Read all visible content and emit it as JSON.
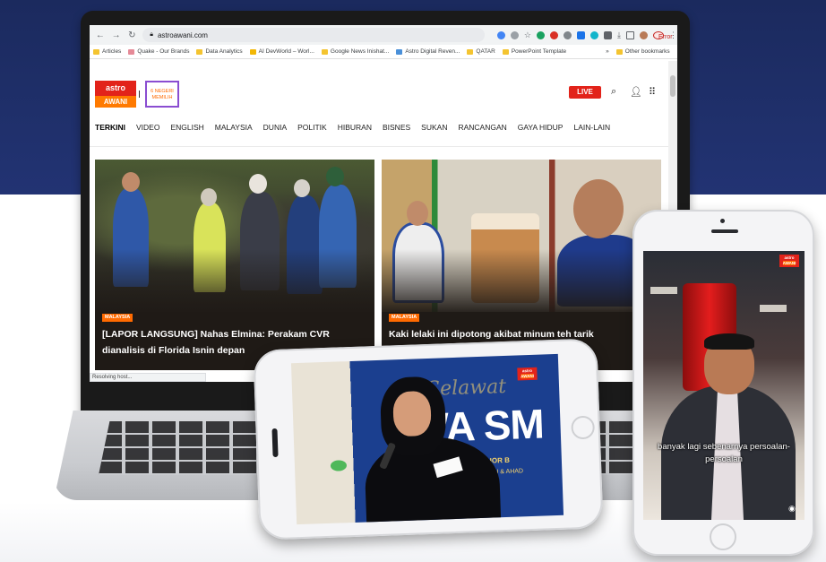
{
  "browser": {
    "url": "astroawani.com",
    "profile_label": "Error",
    "back_icon": "arrow-left-icon",
    "forward_icon": "arrow-right-icon",
    "reload_icon": "reload-icon",
    "bookmarks": [
      "Articles",
      "Quake - Our Brands",
      "Data Analytics",
      "AI DevWorld – Worl...",
      "Google News Inishat...",
      "Astro Digital Reven...",
      "QATAR",
      "PowerPoint Template"
    ],
    "more_bookmarks": "»",
    "other_bookmarks": "Other bookmarks",
    "status_text": "Resolving host..."
  },
  "site": {
    "logo_line1": "astro",
    "logo_line2": "AWANI",
    "partner_logo": "6 NEGERI MEMILIH",
    "live_label": "LIVE",
    "nav": [
      "TERKINI",
      "VIDEO",
      "ENGLISH",
      "MALAYSIA",
      "DUNIA",
      "POLITIK",
      "HIBURAN",
      "BISNES",
      "SUKAN",
      "RANCANGAN",
      "GAYA HIDUP",
      "LAIN-LAIN"
    ]
  },
  "articles": [
    {
      "tag": "MALAYSIA",
      "title": "[LAPOR LANGSUNG] Nahas Elmina: Perakam CVR dianalisis di Florida Isnin depan"
    },
    {
      "tag": "MALAYSIA",
      "title": "Kaki lelaki ini dipotong akibat minum teh tarik"
    }
  ],
  "landscape_phone": {
    "banner_text": "WA SM",
    "banner_script": "Selawat",
    "banner_line1": "UN CITY, JOHOR B",
    "banner_line2": "| SABTU & AHAD",
    "watermark_line1": "astro",
    "watermark_line2": "AWANI"
  },
  "portrait_phone": {
    "caption": "banyak lagi sebenarnya persoalan-persoalan",
    "watermark_line1": "astro",
    "watermark_line2": "AWANI"
  },
  "colors": {
    "brand_red": "#e2231a",
    "brand_orange": "#ff6a00",
    "backdrop_navy": "#1b2a5e"
  }
}
